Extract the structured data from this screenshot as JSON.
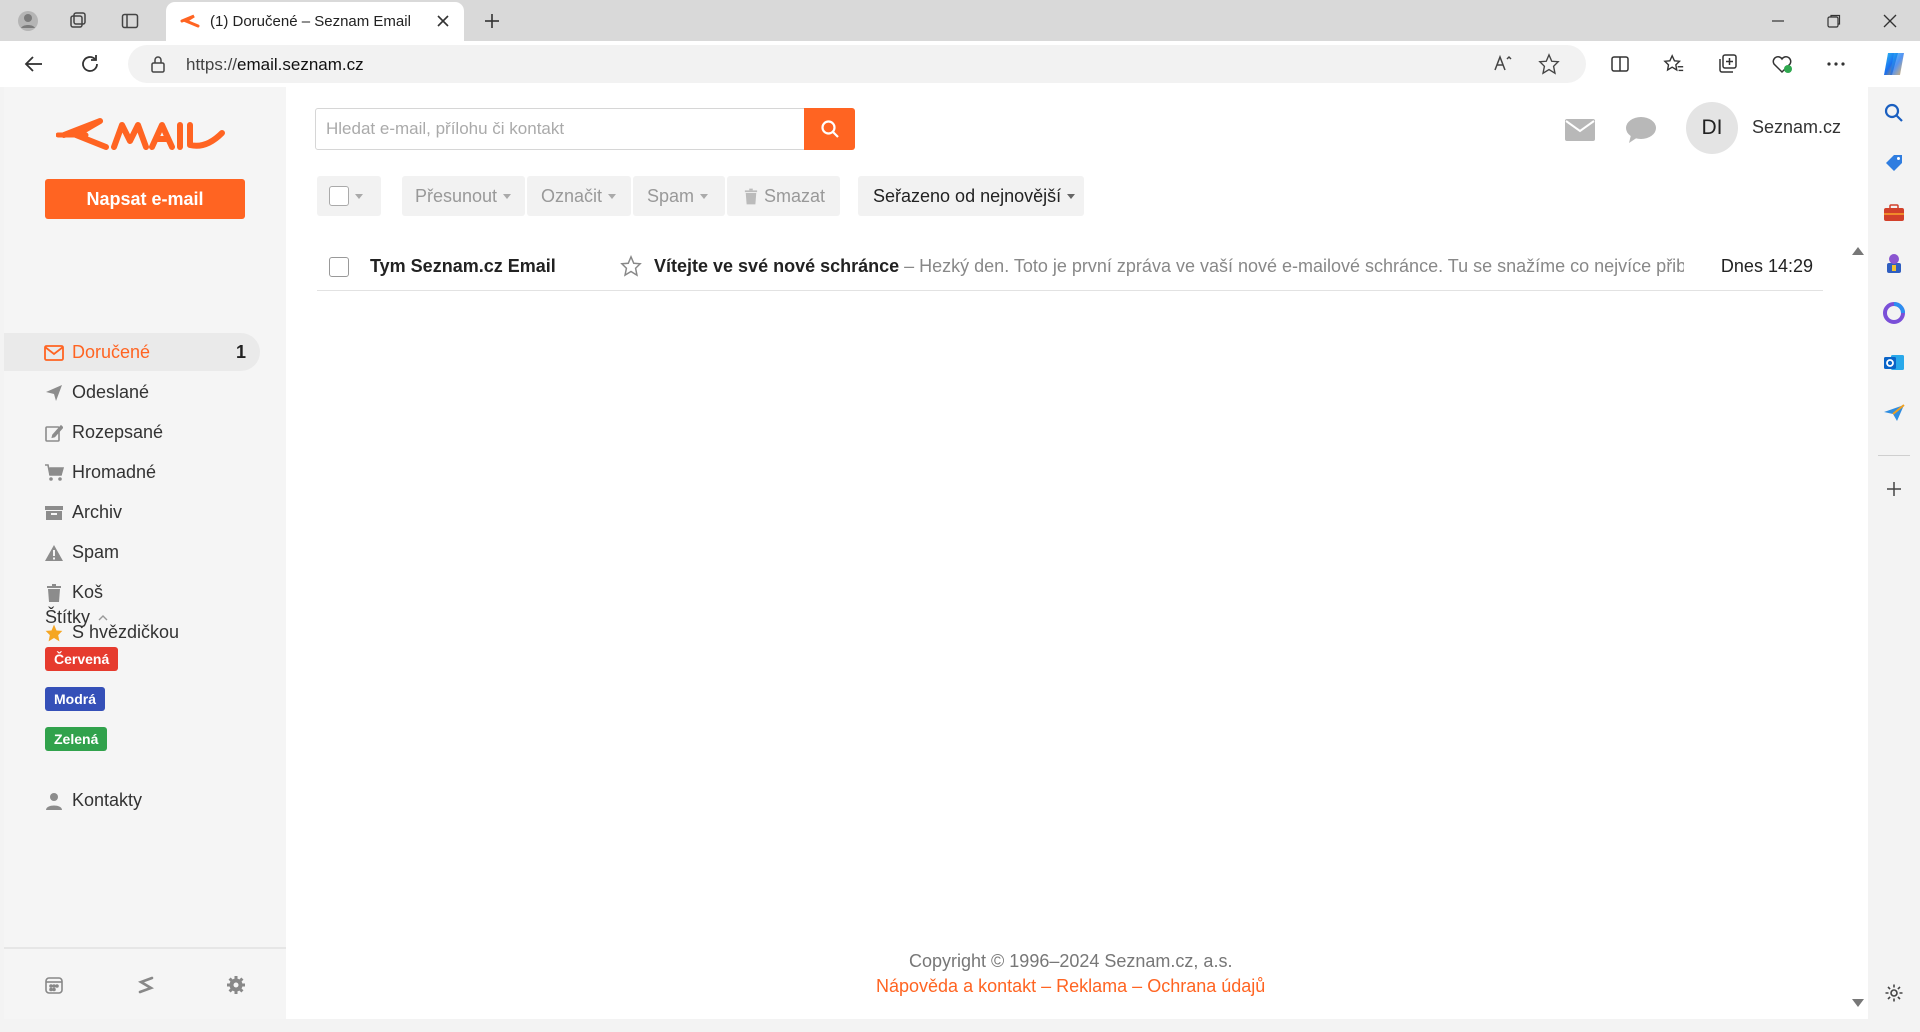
{
  "browser": {
    "tab_title": "(1) Doručené – Seznam Email",
    "url_prefix": "https://",
    "url_host": "email.seznam.cz"
  },
  "sidebar": {
    "compose_label": "Napsat e-mail",
    "folders": [
      {
        "label": "Doručené",
        "count": "1",
        "icon": "inbox-icon"
      },
      {
        "label": "Odeslané",
        "icon": "send-icon"
      },
      {
        "label": "Rozepsané",
        "icon": "draft-icon"
      },
      {
        "label": "Hromadné",
        "icon": "cart-icon"
      },
      {
        "label": "Archiv",
        "icon": "archive-icon"
      },
      {
        "label": "Spam",
        "icon": "warning-icon"
      },
      {
        "label": "Koš",
        "icon": "trash-icon"
      },
      {
        "label": "S hvězdičkou",
        "icon": "star-icon"
      }
    ],
    "labels_heading": "Štítky",
    "tags": [
      {
        "label": "Červená",
        "color": "#e63b2e"
      },
      {
        "label": "Modrá",
        "color": "#3550b8"
      },
      {
        "label": "Zelená",
        "color": "#31a24c"
      }
    ],
    "contacts_label": "Kontakty"
  },
  "search": {
    "placeholder": "Hledat e-mail, přílohu či kontakt"
  },
  "header": {
    "avatar_initials": "DI",
    "account_name": "Seznam.cz"
  },
  "toolbar": {
    "move_label": "Přesunout",
    "mark_label": "Označit",
    "spam_label": "Spam",
    "delete_label": "Smazat",
    "sort_label": "Seřazeno od nejnovější"
  },
  "messages": [
    {
      "sender": "Tym Seznam.cz Email",
      "subject": "Vítejte ve své nové schránce",
      "snippet": " – Hezký den.   Toto je první zpráva ve vaší nové e-mailové schránce. Tu se snažíme co nejvíce přiblížit",
      "date": "Dnes 14:29"
    }
  ],
  "footer": {
    "copyright": "Copyright © 1996–2024 Seznam.cz, a.s.",
    "help": "Nápověda a kontakt",
    "ads": "Reklama",
    "privacy": "Ochrana údajů",
    "separator": " – "
  },
  "colors": {
    "accent": "#ff6422"
  }
}
